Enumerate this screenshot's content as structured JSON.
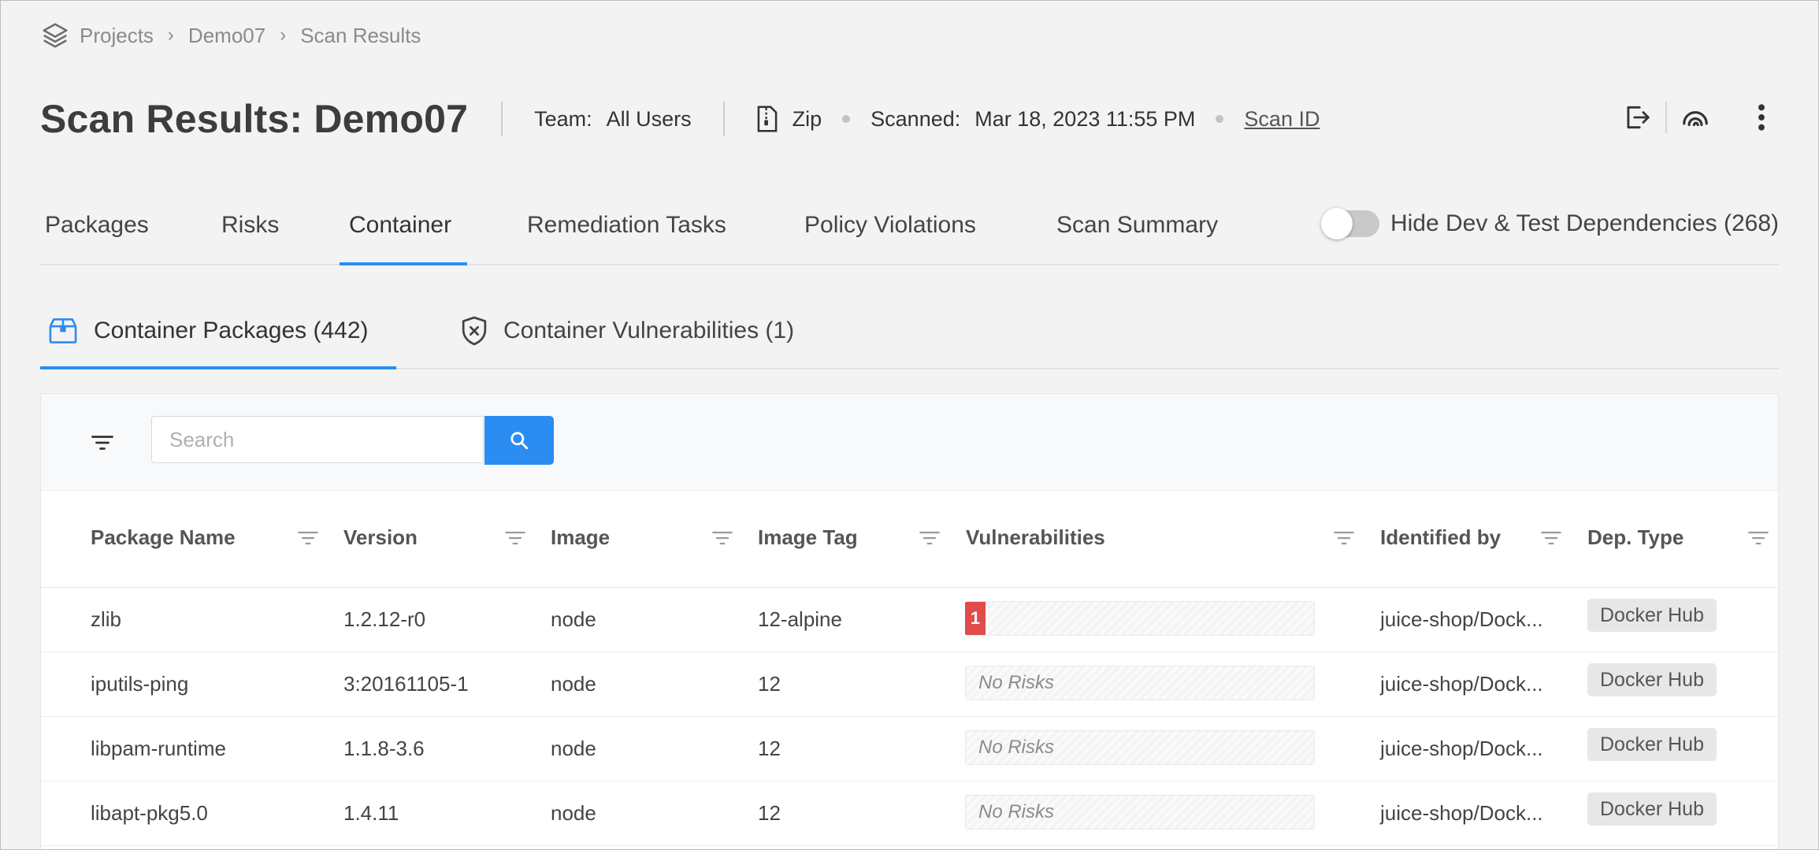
{
  "breadcrumb": {
    "items": [
      "Projects",
      "Demo07",
      "Scan Results"
    ]
  },
  "header": {
    "title": "Scan Results: Demo07",
    "team_label": "Team:",
    "team_value": "All Users",
    "source": "Zip",
    "scanned_label": "Scanned:",
    "scanned_value": "Mar 18, 2023 11:55 PM",
    "scan_id": "Scan ID"
  },
  "tabs": [
    "Packages",
    "Risks",
    "Container",
    "Remediation Tasks",
    "Policy Violations",
    "Scan Summary"
  ],
  "active_tab": "Container",
  "toggle": {
    "label": "Hide Dev & Test Dependencies (268)",
    "on": false
  },
  "subtabs": [
    "Container Packages (442)",
    "Container Vulnerabilities (1)"
  ],
  "search": {
    "placeholder": "Search",
    "value": ""
  },
  "table": {
    "columns": [
      "Package Name",
      "Version",
      "Image",
      "Image Tag",
      "Vulnerabilities",
      "Identified by",
      "Dep. Type"
    ],
    "rows": [
      {
        "name": "zlib",
        "version": "1.2.12-r0",
        "image": "node",
        "tag": "12-alpine",
        "vuln_count": "1",
        "vuln_text": "",
        "identified_by": "juice-shop/Dock...",
        "dep_type": "Docker Hub"
      },
      {
        "name": "iputils-ping",
        "version": "3:20161105-1",
        "image": "node",
        "tag": "12",
        "vuln_count": "",
        "vuln_text": "No Risks",
        "identified_by": "juice-shop/Dock...",
        "dep_type": "Docker Hub"
      },
      {
        "name": "libpam-runtime",
        "version": "1.1.8-3.6",
        "image": "node",
        "tag": "12",
        "vuln_count": "",
        "vuln_text": "No Risks",
        "identified_by": "juice-shop/Dock...",
        "dep_type": "Docker Hub"
      },
      {
        "name": "libapt-pkg5.0",
        "version": "1.4.11",
        "image": "node",
        "tag": "12",
        "vuln_count": "",
        "vuln_text": "No Risks",
        "identified_by": "juice-shop/Dock...",
        "dep_type": "Docker Hub"
      }
    ]
  },
  "colors": {
    "accent": "#2b8cf2",
    "critical": "#e24b4b",
    "badge_bg": "#e7e7e7"
  }
}
